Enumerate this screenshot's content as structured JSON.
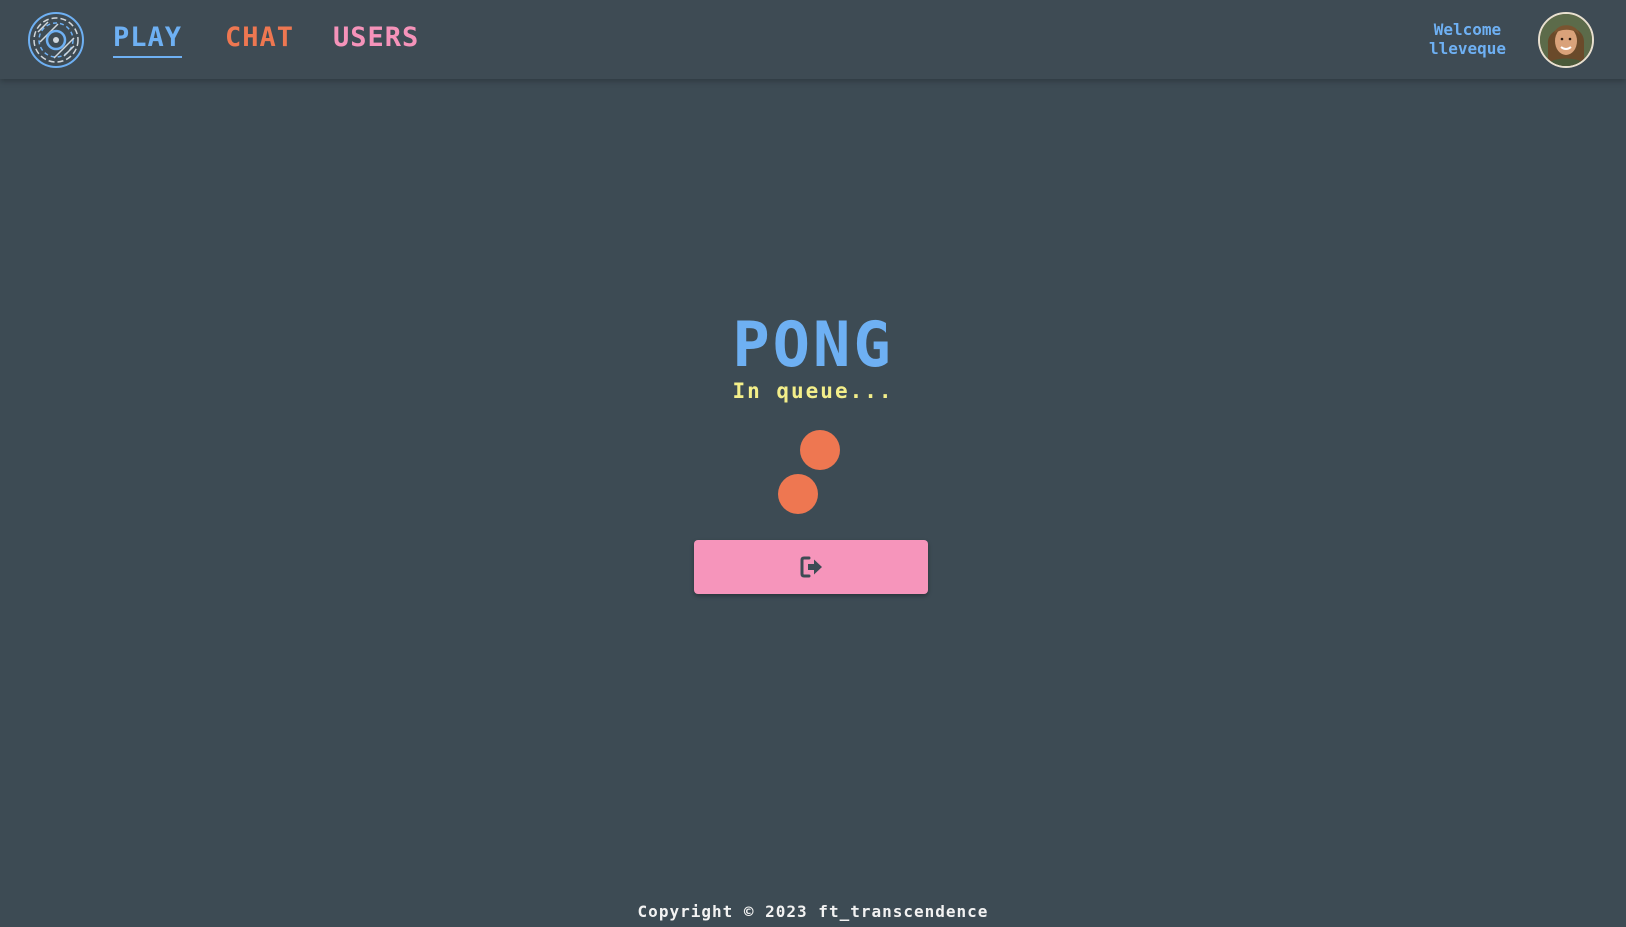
{
  "navbar": {
    "logo_icon": "vinyl-record-logo-icon",
    "links": [
      {
        "label": "PLAY",
        "color": "#6eb0f3",
        "active": true
      },
      {
        "label": "CHAT",
        "color": "#ee7751",
        "active": false
      },
      {
        "label": "USERS",
        "color": "#f593ba",
        "active": false
      }
    ],
    "welcome_line1": "Welcome",
    "welcome_line2": "lleveque",
    "avatar_icon": "user-avatar"
  },
  "main": {
    "title": "PONG",
    "status": "In queue...",
    "loader_icon": "bouncing-balls-loader",
    "leave_button_icon": "sign-out-icon"
  },
  "footer": {
    "text": "Copyright © 2023 ft_transcendence"
  },
  "colors": {
    "background": "#3d4b54",
    "blue": "#6eb0f3",
    "orange": "#ee7751",
    "pink": "#f695bb",
    "yellow": "#f4ef8a"
  }
}
